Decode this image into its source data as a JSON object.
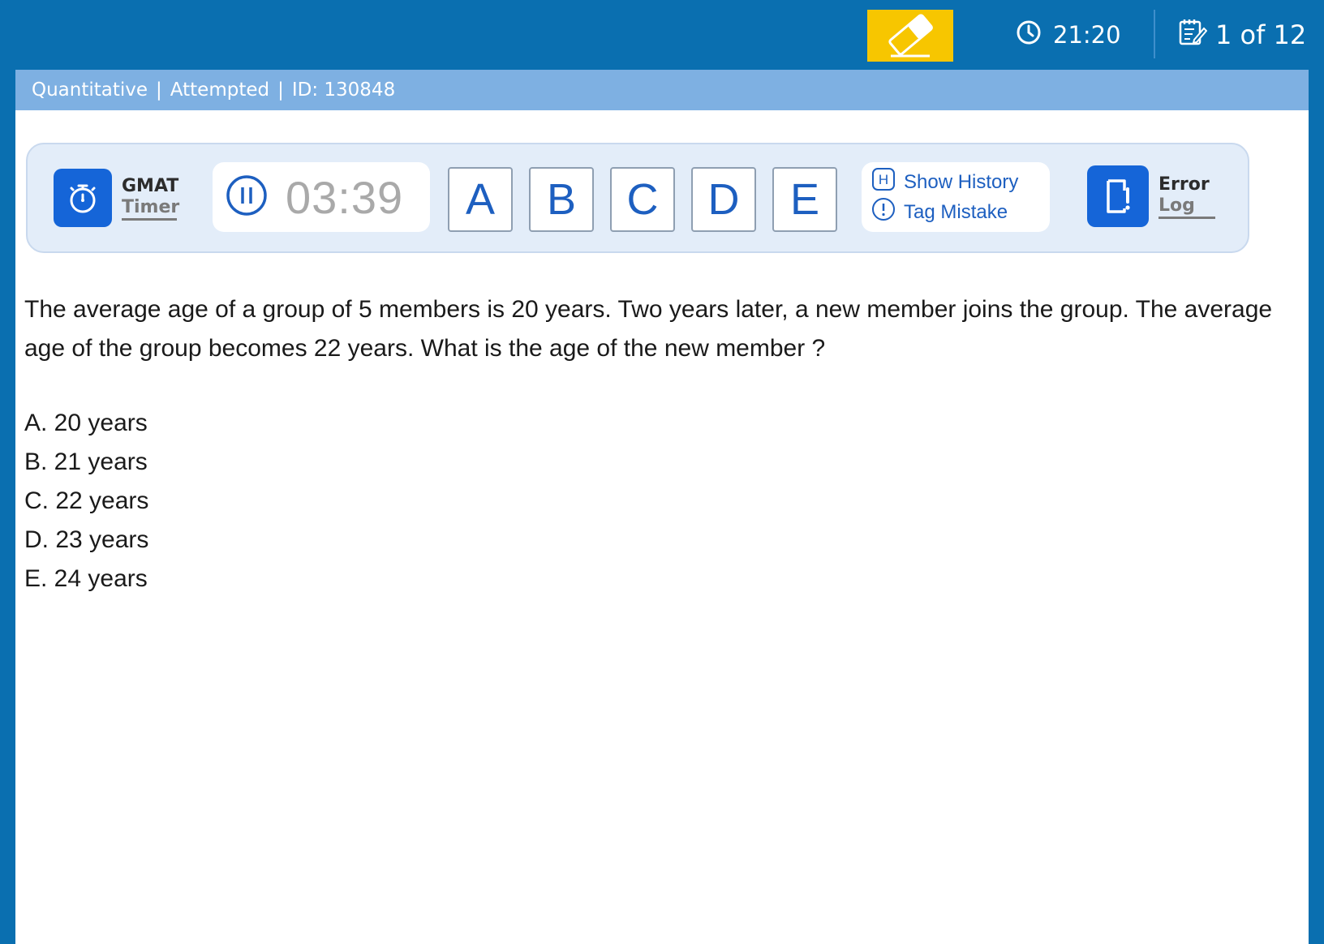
{
  "topbar": {
    "eraser_icon": "eraser-icon",
    "total_time": "21:20",
    "clock_icon": "clock-icon",
    "counter": "1 of 12",
    "notes_icon": "notepad-icon"
  },
  "meta": {
    "section": "Quantitative",
    "status": "Attempted",
    "id": "ID: 130848",
    "separator": "|"
  },
  "toolbar": {
    "gmat_line1": "GMAT",
    "gmat_line2": "Timer",
    "stopwatch_time": "03:39",
    "answers": [
      "A",
      "B",
      "C",
      "D",
      "E"
    ],
    "show_history": "Show History",
    "history_key": "H",
    "tag_mistake": "Tag Mistake",
    "error_line1": "Error",
    "error_line2": "Log"
  },
  "question": {
    "text": "The average age of a group of 5 members is 20 years. Two years later, a new member joins the group. The average age of the group becomes 22 years. What is the age of the new member ?",
    "options": [
      "A. 20 years",
      "B. 21 years",
      "C. 22 years",
      "D. 23 years",
      "E. 24 years"
    ]
  },
  "colors": {
    "topbar": "#0a6fb0",
    "strip": "#7eb0e2",
    "eraser_bg": "#f7c600",
    "accent_blue": "#1565d8"
  }
}
